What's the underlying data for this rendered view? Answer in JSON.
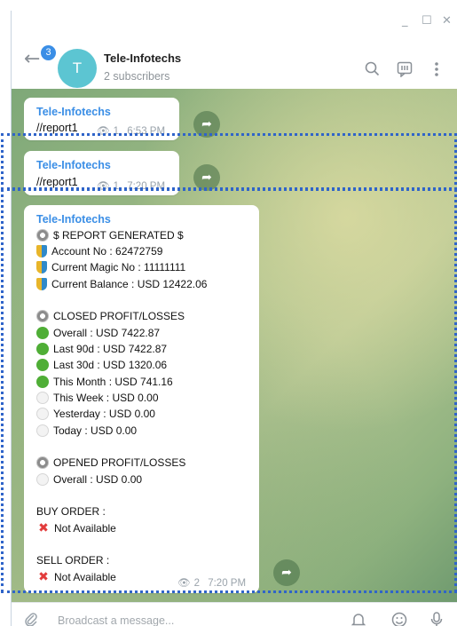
{
  "window": {
    "minimize": "_",
    "maximize": "☐",
    "close": "✕"
  },
  "header": {
    "back_icon": "arrow-left-icon",
    "unread_badge": "3",
    "avatar_letter": "T",
    "title": "Tele-Infotechs",
    "subtitle": "2 subscribers",
    "icons": [
      "search-icon",
      "comment-icon",
      "more-vertical-icon"
    ]
  },
  "messages": [
    {
      "sender": "Tele-Infotechs",
      "text": "//report1",
      "views": "1",
      "time": "6:53 PM"
    },
    {
      "sender": "Tele-Infotechs",
      "text": "//report1",
      "views": "1",
      "time": "7:20 PM"
    }
  ],
  "report": {
    "sender": "Tele-Infotechs",
    "views": "2",
    "time": "7:20 PM",
    "lines": [
      {
        "icon": "gear-icon",
        "text": "$ REPORT GENERATED $"
      },
      {
        "icon": "shield-icon",
        "text": "Account No : 62472759"
      },
      {
        "icon": "shield-icon",
        "text": "Current Magic No : 11111111"
      },
      {
        "icon": "shield-icon",
        "text": "Current Balance : USD 12422.06"
      },
      {
        "icon": "gear-icon",
        "text": "CLOSED PROFIT/LOSSES"
      },
      {
        "icon": "green-circle-icon",
        "text": "Overall : USD 7422.87"
      },
      {
        "icon": "green-circle-icon",
        "text": "Last 90d : USD 7422.87"
      },
      {
        "icon": "green-circle-icon",
        "text": "Last 30d : USD 1320.06"
      },
      {
        "icon": "green-circle-icon",
        "text": "This Month : USD 741.16"
      },
      {
        "icon": "white-circle-icon",
        "text": "This Week : USD 0.00"
      },
      {
        "icon": "white-circle-icon",
        "text": "Yesterday : USD 0.00"
      },
      {
        "icon": "white-circle-icon",
        "text": "Today : USD 0.00"
      },
      {
        "icon": "gear-icon",
        "text": "OPENED PROFIT/LOSSES"
      },
      {
        "icon": "white-circle-icon",
        "text": "Overall : USD 0.00"
      },
      {
        "icon": "",
        "text": "BUY ORDER :"
      },
      {
        "icon": "cross-mark-icon",
        "text": "Not Available"
      },
      {
        "icon": "",
        "text": "SELL ORDER :"
      },
      {
        "icon": "cross-mark-icon",
        "text": "Not Available"
      }
    ]
  },
  "composer": {
    "placeholder": "Broadcast a message...",
    "icons": [
      "paperclip-icon",
      "bell-icon",
      "emoji-icon",
      "microphone-icon"
    ]
  },
  "colors": {
    "accent": "#3a8ee6",
    "avatar": "#5cc5d2",
    "highlight_border": "#2f64c9"
  }
}
